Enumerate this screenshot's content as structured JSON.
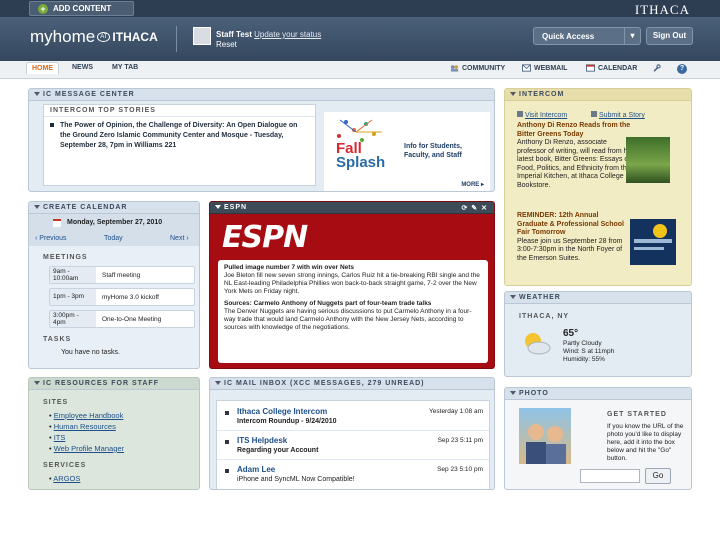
{
  "topbar": {
    "add_content": "ADD CONTENT",
    "logo": "ITHACA"
  },
  "header": {
    "brand_main": "myhome",
    "brand_at": "AT",
    "brand_suffix": "ITHACA",
    "user_name": "Staff Test",
    "update_link": "Update your status",
    "user_sub": "Reset",
    "quick_access": "Quick Access",
    "sign_out": "Sign Out"
  },
  "nav": {
    "tabs": [
      "HOME",
      "NEWS",
      "MY TAB"
    ],
    "right": [
      "COMMUNITY",
      "WEBMAIL",
      "CALENDAR"
    ]
  },
  "message_center": {
    "title": "IC MESSAGE CENTER",
    "subtitle": "INTERCOM TOP STORIES",
    "story": "The Power of Opinion, the Challenge of Diversity: An Open Dialogue on the Ground Zero Islamic Community Center and Mosque - Tuesday, September 28, 7pm in Williams 221",
    "promo_line1": "Fall",
    "promo_line2": "Splash",
    "promo_text": "Info for Students, Faculty, and Staff",
    "promo_more": "MORE ▸"
  },
  "intercom": {
    "title": "INTERCOM",
    "visit_link": "Visit Intercom",
    "submit_link": "Submit a Story",
    "story1_title": "Anthony Di Renzo Reads from the Bitter Greens Today",
    "story1_body": "Anthony Di Renzo, associate professor of writing, will read from his latest book, Bitter Greens: Essays on Food, Politics, and Ethnicity from the Imperial Kitchen, at Ithaca College Bookstore.",
    "story2_title": "REMINDER: 12th Annual Graduate & Professional School Fair Tomorrow",
    "story2_body": "Please join us September 28 from 3:00-7:30pm in the North Foyer of the Emerson Suites."
  },
  "calendar": {
    "title": "CREATE CALENDAR",
    "date": "Monday, September 27, 2010",
    "prev": "‹ Previous",
    "today": "Today",
    "next": "Next ›",
    "meetings_label": "MEETINGS",
    "events": [
      {
        "time": "9am - 10:00am",
        "name": "Staff meeting"
      },
      {
        "time": "1pm - 3pm",
        "name": "myHome 3.0 kickoff"
      },
      {
        "time": "3:00pm - 4pm",
        "name": "One-to-One Meeting"
      }
    ],
    "tasks_label": "TASKS",
    "tasks_empty": "You have no tasks."
  },
  "espn": {
    "title": "ESPN",
    "logo": "ESPN",
    "story1_title": "Pulled image number 7 with win over Nets",
    "story1_body": "Joe Bleton fill new seven strong innings, Carlos Ruiz hit a tie-breaking RBI single and the NL East-leading Philadelphia Phillies won back-to-back straight game, 7-2 over the New York Mets on Friday night.",
    "story2_title": "Sources: Carmelo Anthony of Nuggets part of four-team trade talks",
    "story2_body": "The Denver Nuggets are having serious discussions to put Carmelo Anthony in a four-way trade that would land Carmelo Anthony with the New Jersey Nets, according to sources with knowledge of the negotiations."
  },
  "weather": {
    "title": "WEATHER",
    "location": "ITHACA, NY",
    "temp": "65°",
    "condition": "Partly Cloudy",
    "wind": "Wind: S at 11mph",
    "humidity": "Humidity: 55%"
  },
  "resources": {
    "title": "IC RESOURCES FOR STAFF",
    "sites_label": "SITES",
    "sites": [
      "Employee Handbook",
      "Human Resources",
      "ITS",
      "Web Profile Manager"
    ],
    "services_label": "SERVICES",
    "services": [
      "ARGOS"
    ]
  },
  "inbox": {
    "title": "IC MAIL INBOX (XCC MESSAGES, 279 UNREAD)",
    "messages": [
      {
        "from": "Ithaca College Intercom",
        "subject": "Intercom Roundup - 9/24/2010",
        "time": "Yesterday 1:08 am"
      },
      {
        "from": "ITS Helpdesk",
        "subject": "Regarding your Account",
        "time": "Sep 23 5:11 pm"
      },
      {
        "from": "Adam Lee",
        "subject": "iPhone and SyncML Now Compatible!",
        "time": "Sep 23 5:10 pm"
      }
    ]
  },
  "photo": {
    "title": "PHOTO",
    "get_started": "GET STARTED",
    "instructions": "If you know the URL of the photo you'd like to display here, add it into the box below and hit the \"Go\" button.",
    "go": "Go"
  }
}
